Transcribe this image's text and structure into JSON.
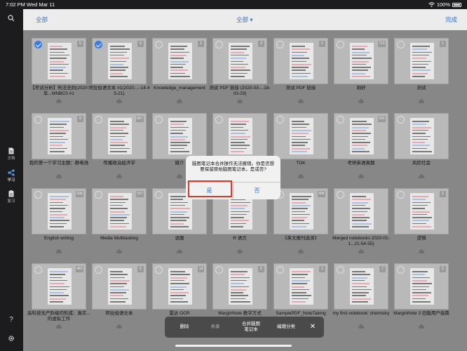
{
  "status_bar": {
    "time": "7:02 PM",
    "date": "Wed Mar 11",
    "battery": "100%"
  },
  "sidebar": {
    "items": [
      {
        "label": "文档",
        "icon": "document-icon"
      },
      {
        "label": "学习",
        "icon": "learn-icon"
      },
      {
        "label": "复习",
        "icon": "review-icon"
      }
    ],
    "help_label": "?"
  },
  "topbar": {
    "left": "全部",
    "center": "全部 ▾",
    "right": "完成"
  },
  "notebooks": [
    {
      "title": "【考试分析】刑法总则(2020年...MNBC0 #1",
      "count": "5",
      "selected": true
    },
    {
      "title": "阿拉伯语文本 #1(2020-...-14-45-21)",
      "count": "5",
      "selected": true
    },
    {
      "title": "Knowledge_management",
      "count": "1",
      "selected": false
    },
    {
      "title": "测试 PDF 链接 (2020-03-...18-03-29)",
      "count": "3",
      "selected": false
    },
    {
      "title": "测试 PDF 链接",
      "count": "1",
      "selected": false
    },
    {
      "title": "刚好",
      "count": "713",
      "selected": false
    },
    {
      "title": "测试",
      "count": "1",
      "selected": false
    },
    {
      "title": "我的第一个学习主题：静电场",
      "count": "8",
      "selected": false
    },
    {
      "title": "传播政治经济学",
      "count": "867",
      "selected": false
    },
    {
      "title": "媒介",
      "count": "",
      "selected": false
    },
    {
      "title": "",
      "count": "",
      "selected": false
    },
    {
      "title": "TOK",
      "count": "",
      "selected": false
    },
    {
      "title": "考研英语真题",
      "count": "292",
      "selected": false
    },
    {
      "title": "风险社会",
      "count": "",
      "selected": false
    },
    {
      "title": "English writing",
      "count": "306",
      "selected": false
    },
    {
      "title": "Media Multitasking",
      "count": "157",
      "selected": false
    },
    {
      "title": "说服",
      "count": "",
      "selected": false
    },
    {
      "title": "R 语言",
      "count": "",
      "selected": false
    },
    {
      "title": "《英文报刊选读》",
      "count": "494",
      "selected": false
    },
    {
      "title": "Merged notebooks 2020-01-1...21-54-55)",
      "count": "",
      "selected": false
    },
    {
      "title": "逻辑",
      "count": "1",
      "selected": false
    },
    {
      "title": "高科技无产阶级的形成：真实...的虚拟工作",
      "count": "483",
      "selected": false
    },
    {
      "title": "阿拉伯语文本",
      "count": "5",
      "selected": false
    },
    {
      "title": "雷达 OCR",
      "count": "14",
      "selected": false
    },
    {
      "title": "MarginNote 教学方式",
      "count": "6",
      "selected": false
    },
    {
      "title": "SamplePDF_NoteTaking",
      "count": "1",
      "selected": false
    },
    {
      "title": "my first notebook: chemistry",
      "count": "7",
      "selected": false
    },
    {
      "title": "MarginNote 3 旧版用户指南",
      "count": "5",
      "selected": false
    }
  ],
  "dialog": {
    "message": "脑图笔记本合并操作无法撤销。你是否想要保留原始脑图笔记本，是或否?",
    "yes": "是",
    "no": "否"
  },
  "action_bar": {
    "delete": "删除",
    "share": "共享",
    "merge_line1": "合并脑图",
    "merge_line2": "笔记本",
    "edit_category": "编辑分类",
    "close": "✕"
  }
}
